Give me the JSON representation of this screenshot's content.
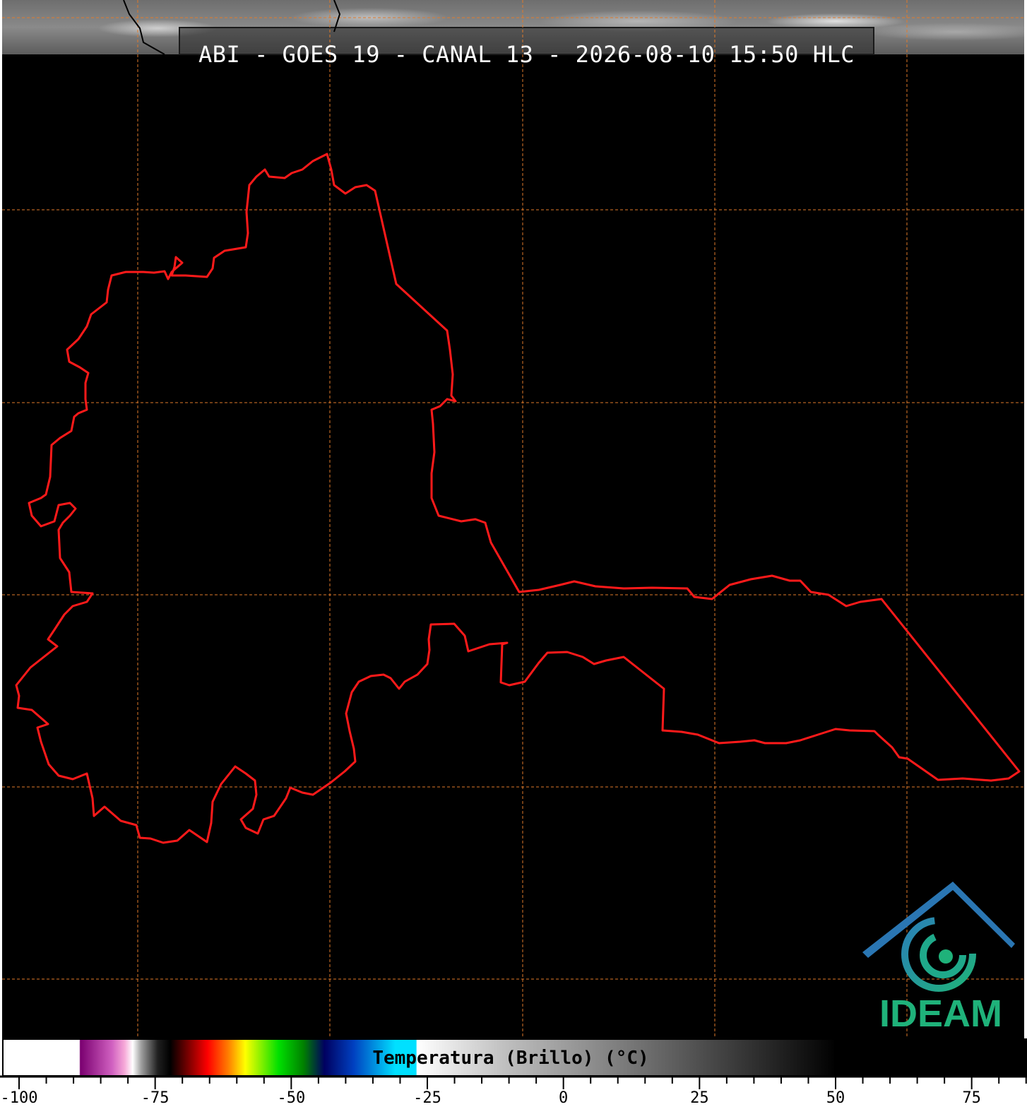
{
  "map": {
    "title": "ABI - GOES 19 - CANAL 13 - 2026-08-10 15:50 HLC",
    "boundary_color": "#ff1a1a",
    "grid_color": "#e07a2a",
    "background_color": "#000000"
  },
  "logo": {
    "text": "IDEAM",
    "text_color": "#1fb27a",
    "icon": "ideam-roof-swirl-icon"
  },
  "colorbar": {
    "label": "Temperatura (Brillo) (°C)",
    "min": -100,
    "max": 50,
    "ticks": [
      "-100",
      "-75",
      "-50",
      "-25",
      "0",
      "25",
      "50",
      "75"
    ]
  }
}
